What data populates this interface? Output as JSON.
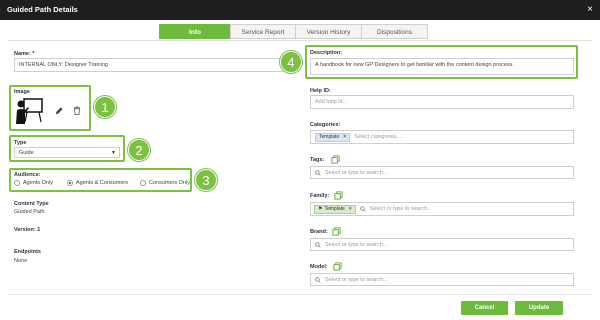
{
  "window": {
    "title": "Guided Path Details",
    "close_glyph": "×"
  },
  "tabs": [
    {
      "label": "Info",
      "active": true
    },
    {
      "label": "Service Report",
      "active": false
    },
    {
      "label": "Version History",
      "active": false
    },
    {
      "label": "Dispositions",
      "active": false
    }
  ],
  "left": {
    "name_label": "Name: *",
    "name_value": "INTERNAL ONLY: Designer Training",
    "image_label": "Image",
    "type_label": "Type",
    "type_value": "Guide",
    "audience_label": "Audience:",
    "audience_options": [
      "Agents Only",
      "Agents & Consumers",
      "Consumers Only"
    ],
    "audience_selected": "Agents & Consumers",
    "content_type_label": "Content Type",
    "content_type_value": "Guided Path",
    "version_label": "Version: 1",
    "endpoints_label": "Endpoints",
    "endpoints_value": "None"
  },
  "right": {
    "description_label": "Description:",
    "description_value": "A handbook for new GP Designers to get familiar with the content design process.",
    "help_id_label": "Help ID:",
    "help_id_placeholder": "Add help id...",
    "categories_label": "Categories:",
    "categories_chip": "Template",
    "categories_placeholder": "Select categories...",
    "tags_label": "Tags:",
    "tags_placeholder": "Select or type to search...",
    "family_label": "Family:",
    "family_chip": "Template",
    "family_placeholder": "Select or type to search...",
    "brand_label": "Brand:",
    "brand_placeholder": "Select or type to search...",
    "model_label": "Model:",
    "model_placeholder": "Select or type to search..."
  },
  "callouts": [
    "1",
    "2",
    "3",
    "4"
  ],
  "footer": {
    "cancel_label": "Cancel",
    "update_label": "Update"
  },
  "colors": {
    "accent": "#6cbb3c",
    "highlight": "#7cc142",
    "titlebar": "#1e1e1e",
    "chip_blue": "#dbe8f4",
    "chip_green": "#d9ecc9"
  },
  "icons": [
    "presentation-image-icon",
    "pencil-icon",
    "trash-icon",
    "copy-icon",
    "search-icon",
    "tag-icon",
    "close-icon",
    "chevron-down-icon"
  ]
}
